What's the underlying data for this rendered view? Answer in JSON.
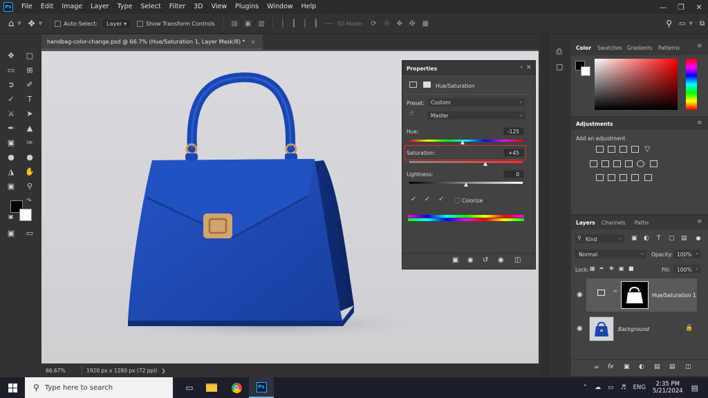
{
  "menubar": {
    "logo": "Ps",
    "items": [
      "File",
      "Edit",
      "Image",
      "Layer",
      "Type",
      "Select",
      "Filter",
      "3D",
      "View",
      "Plugins",
      "Window",
      "Help"
    ]
  },
  "options_bar": {
    "auto_select_label": "Auto-Select:",
    "auto_select_value": "Layer",
    "show_transform_label": "Show Transform Controls",
    "mode_label": "3D Mode:"
  },
  "document": {
    "tab_title": "handbag-color-change.psd @ 66.7% (Hue/Saturation 1, Layer Mask/8) *",
    "zoom": "66.67%",
    "dimensions": "1920 px x 1280 px (72 ppi)"
  },
  "properties": {
    "title": "Properties",
    "subtitle": "Hue/Saturation",
    "preset_label": "Preset:",
    "preset_value": "Custom",
    "channel_value": "Master",
    "hue_label": "Hue:",
    "hue_value": "-125",
    "saturation_label": "Saturation:",
    "saturation_value": "+45",
    "lightness_label": "Lightness:",
    "lightness_value": "0",
    "colorize_label": "Colorize"
  },
  "color_panel": {
    "tabs": [
      "Color",
      "Swatches",
      "Gradients",
      "Patterns"
    ]
  },
  "adjustments_panel": {
    "title": "Adjustments",
    "hint": "Add an adjustment"
  },
  "layers_panel": {
    "tabs": [
      "Layers",
      "Channels",
      "Paths"
    ],
    "filter_label": "Kind",
    "blend_mode": "Normal",
    "opacity_label": "Opacity:",
    "opacity_value": "100%",
    "lock_label": "Lock:",
    "fill_label": "Fill:",
    "fill_value": "100%",
    "layers": [
      {
        "name": "Hue/Saturation 1"
      },
      {
        "name": "Background"
      }
    ]
  },
  "taskbar": {
    "search_placeholder": "Type here to search",
    "language": "ENG",
    "time": "2:35 PM",
    "date": "5/21/2024"
  },
  "colors": {
    "ps_blue": "#31a8ff",
    "highlight_red": "#e0302a",
    "bag_blue": "#1b45b0"
  }
}
